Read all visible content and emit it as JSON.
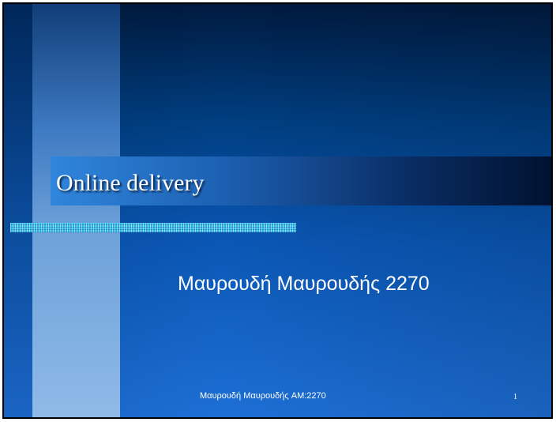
{
  "slide": {
    "title": "Online delivery",
    "subtitle": "Μαυρουδή Μαυρουδής 2270",
    "footer": "Μαυρουδή Μαυρουδής AM:2270",
    "page_number": "1"
  },
  "colors": {
    "background_top": "#001a3f",
    "background_bottom": "#1d6fd6",
    "accent_stripe": "#33bbee",
    "text": "#ffffff"
  }
}
